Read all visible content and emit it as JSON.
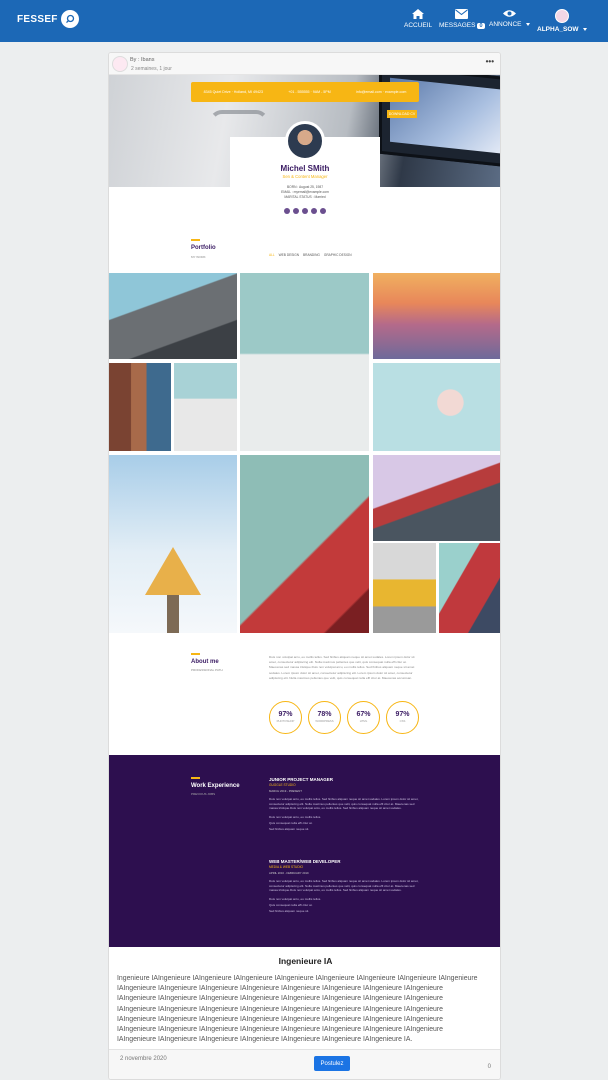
{
  "nav": {
    "brand": "FESSEF",
    "items": [
      {
        "label": "ACCUEIL",
        "icon": "home-icon"
      },
      {
        "label": "MESSAGES",
        "icon": "envelope-icon",
        "badge": "0"
      },
      {
        "label": "ANNONCE",
        "icon": "eye-icon"
      },
      {
        "label": "ALPHA_SOW",
        "icon": "avatar"
      }
    ]
  },
  "post": {
    "author": "By : Ibans",
    "time_ago": "2 semaines, 1 jour",
    "title": "Ingenieure IA",
    "body": "Ingenieure IAIngenieure IAIngenieure IAIngenieure IAIngenieure IAIngenieure IAIngenieure IAIngenieure IAIngenieure IAIngenieure IAIngenieure IAIngenieure IAIngenieure IAIngenieure IAIngenieure IAIngenieure IAIngenieure IAIngenieure IAIngenieure IAIngenieure IAIngenieure IAIngenieure IAIngenieure IAIngenieure IAIngenieure IAIngenieure IAIngenieure IAIngenieure IAIngenieure IAIngenieure IAIngenieure IAIngenieure IAIngenieure IAIngenieure IAIngenieure IAIngenieure IAIngenieure IAIngenieure IAIngenieure IAIngenieure IAIngenieure IAIngenieure IAIngenieure IAIngenieure IAIngenieure IAIngenieure IAIngenieure IAIngenieure IAIngenieure IAIngenieure IAIngenieure IAIngenieure IAIngenieure IAIngenieure IAIngenieure IAIngenieure IA.",
    "date": "2 novembre 2020",
    "apply_label": "Postulez",
    "count": "0"
  },
  "cv": {
    "info": [
      "8345 Quiet Drive · Holland, MI 49423",
      "+01 - 555555 · 9AM - 5PM",
      "info@email.com · example.com"
    ],
    "hire_label": "DOWNLOAD CV",
    "name": "Michel SMith",
    "role": "Sen & Content Manager",
    "facts": [
      "BORN : August 25, 1987",
      "EMAIL : myemail@example.com",
      "MARITAL STATUS : Married"
    ],
    "portfolio_title": "Portfolio",
    "portfolio_sub": "MY WORK",
    "filters": [
      "ALL",
      "WEB DESIGN",
      "BRANDING",
      "GRAPHIC DESIGN"
    ],
    "about_title": "About me",
    "about_sub": "PROFESSIONAL PATH",
    "about_text": "Duis non volutpat arcu, eu mollis tellus. Sed finibus aliquam neque sit amet sodales. Lorem ipsum dolor sit amet, consectetur adipiscing elit. Nulla maximus pellentes que velit, quis consequat nulla effi citur at. Maecenas sed massa tristique.Duis non volutpat arcu, eu mollis tellus. Sed finibus aliquam neque sit amet sodales. Lorem ipsum dolor sit amet, consectetur adipiscing elit. Lorem ipsum dolor sit amet, consectetur adipiscing elit. Nulla maximus pellentes que velit, quis consequat nulla effi citur at. Maecenas accumsan.",
    "skills": [
      {
        "value": "97%",
        "label": "PHOTOSHOP"
      },
      {
        "value": "78%",
        "label": "WORDPRESS"
      },
      {
        "value": "67%",
        "label": "HTML"
      },
      {
        "value": "97%",
        "label": "CSS"
      }
    ],
    "work_title": "Work Experience",
    "work_sub": "PREVIOUS JOBS",
    "jobs": [
      {
        "title": "JUNIOR PROJECT MANAGER",
        "company": "GUGGLE STUDIO",
        "dates": "MARCH 2019 - PRESENT",
        "text": "Duis non volutpat arcu, eu mollis tellus. Sed finibus aliquam neque sit amet sodales. Lorem ipsum dolor sit amet, consectetur adipiscing elit. Nulla maximus pellentes que velit, quis consequat nulla effi citur at. Maecenas sed massa tristique.Duis non volutpat arcu, eu mollis tellus. Sed finibus aliquam neque sit amet sodales.",
        "bullets": [
          "Duis non volutpat arcu, eu mollis tellus.",
          "Quis consequat nulla effi citur at.",
          "Sed finibus aliquam neque sit."
        ]
      },
      {
        "title": "WEB MASTER/WEB DEVELOPER",
        "company": "MEDIA & WEB STUDIO",
        "dates": "APRIL 2016 - FEBRUARY 2019",
        "text": "Duis non volutpat arcu, eu mollis tellus. Sed finibus aliquam neque sit amet sodales. Lorem ipsum dolor sit amet, consectetur adipiscing elit. Nulla maximus pellentes que velit, quis consequat nulla effi citur at. Maecenas sed massa tristique.Duis non volutpat arcu, eu mollis tellus. Sed finibus aliquam neque sit amet sodales.",
        "bullets": [
          "Duis non volutpat arcu, eu mollis tellus.",
          "Quis consequat nulla effi citur at.",
          "Sed finibus aliquam neque sit."
        ]
      }
    ]
  },
  "colors": {
    "navbar": "#1c68b6",
    "accent": "#f7b614",
    "work_bg": "#2d0f4f",
    "button": "#1b74e4"
  }
}
